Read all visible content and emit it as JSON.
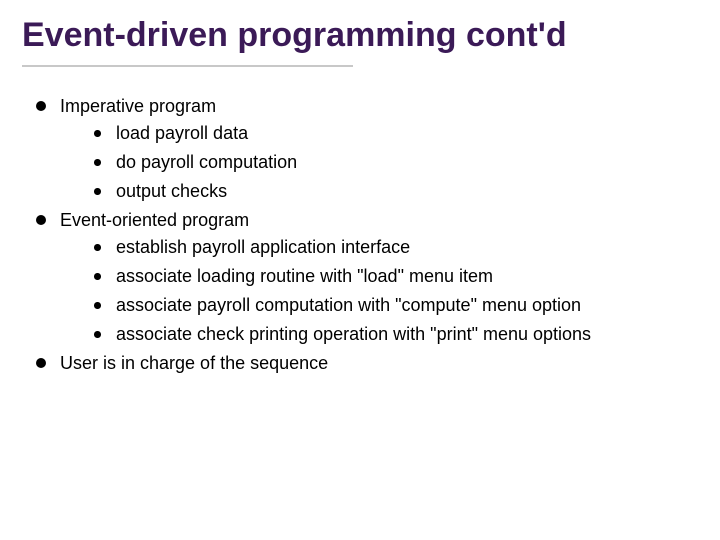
{
  "title": "Event-driven programming cont'd",
  "bullets": [
    {
      "text": "Imperative program",
      "children": [
        {
          "text": "load payroll data"
        },
        {
          "text": "do payroll computation"
        },
        {
          "text": "output checks"
        }
      ]
    },
    {
      "text": "Event-oriented program",
      "children": [
        {
          "text": "establish payroll application interface"
        },
        {
          "text": "associate loading routine with \"load\" menu item"
        },
        {
          "text": "associate payroll computation with \"compute\" menu option"
        },
        {
          "text": "associate check printing operation with \"print\" menu options"
        }
      ]
    },
    {
      "text": "User is in charge of the sequence",
      "children": []
    }
  ]
}
